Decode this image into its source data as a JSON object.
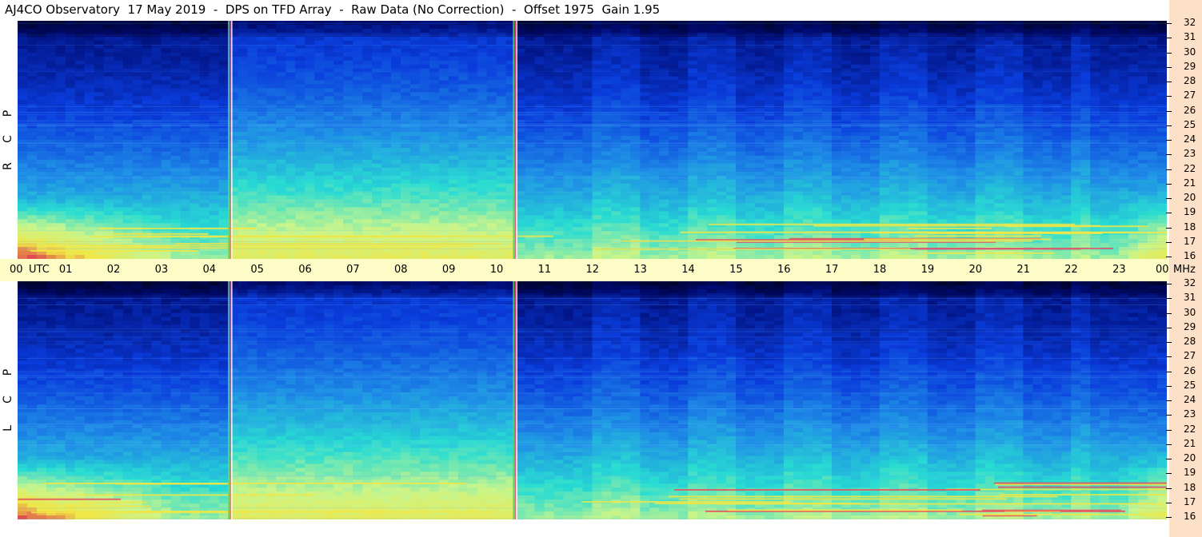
{
  "header": {
    "title": "AJ4CO Observatory  17 May 2019  -  DPS on TFD Array  -  Raw Data (No Correction)  -  Offset 1975  Gain 1.95"
  },
  "panels": [
    {
      "polarization": [
        "R",
        "C",
        "P"
      ]
    },
    {
      "polarization": [
        "L",
        "C",
        "P"
      ]
    }
  ],
  "time_axis": {
    "labels": [
      "00",
      "01",
      "02",
      "03",
      "04",
      "05",
      "06",
      "07",
      "08",
      "09",
      "10",
      "11",
      "12",
      "13",
      "14",
      "15",
      "16",
      "17",
      "18",
      "19",
      "20",
      "21",
      "22",
      "23",
      "00"
    ],
    "utc_label": "UTC",
    "unit_label": "MHz"
  },
  "chart_data": {
    "type": "heatmap",
    "title": "AJ4CO Observatory  17 May 2019  -  DPS on TFD Array  -  Raw Data (No Correction)  -  Offset 1975  Gain 1.95",
    "x_label": "UTC",
    "x_range": [
      0,
      24
    ],
    "y_label": "MHz",
    "y_range": [
      16,
      32
    ],
    "y_ticks": [
      16,
      17,
      18,
      19,
      20,
      21,
      22,
      23,
      24,
      25,
      26,
      27,
      28,
      29,
      30,
      31,
      32
    ],
    "panels": [
      "RCP",
      "LCP"
    ],
    "colormap": [
      "#000010",
      "#000a6e",
      "#0a3cdc",
      "#1e8ce6",
      "#28dcd2",
      "#c8f58c",
      "#f0e646",
      "#dc3c50"
    ],
    "marker_lines_utc": [
      4.42,
      10.37
    ]
  }
}
